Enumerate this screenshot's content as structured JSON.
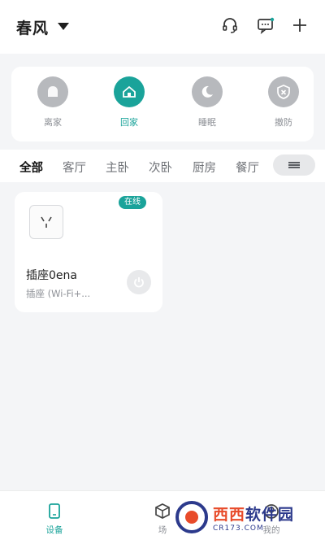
{
  "header": {
    "home_name": "春风",
    "icons": [
      "headset-icon",
      "message-icon",
      "add-icon"
    ]
  },
  "scenes": [
    {
      "label": "离家",
      "icon": "leave-home-icon",
      "active": false
    },
    {
      "label": "回家",
      "icon": "home-icon",
      "active": true
    },
    {
      "label": "睡眠",
      "icon": "moon-icon",
      "active": false
    },
    {
      "label": "撤防",
      "icon": "shield-icon",
      "active": false
    }
  ],
  "tabs": [
    {
      "label": "全部",
      "active": true
    },
    {
      "label": "客厅",
      "active": false
    },
    {
      "label": "主卧",
      "active": false
    },
    {
      "label": "次卧",
      "active": false
    },
    {
      "label": "厨房",
      "active": false
    },
    {
      "label": "餐厅",
      "active": false
    }
  ],
  "device": {
    "status": "在线",
    "name": "插座0ena",
    "type": "插座 (Wi-Fi+...",
    "icon": "socket-icon"
  },
  "bottom_nav": [
    {
      "label": "设备",
      "icon": "device-icon",
      "active": true
    },
    {
      "label": "场",
      "icon": "cube-icon",
      "active": false
    },
    {
      "label": "我的",
      "icon": "user-icon",
      "active": false
    }
  ],
  "watermark": {
    "main_a": "西西",
    "main_b": "软件园",
    "sub": "CR173.COM"
  },
  "colors": {
    "accent": "#1aa39a",
    "inactive": "#b7b9bd",
    "background": "#f4f5f7"
  }
}
